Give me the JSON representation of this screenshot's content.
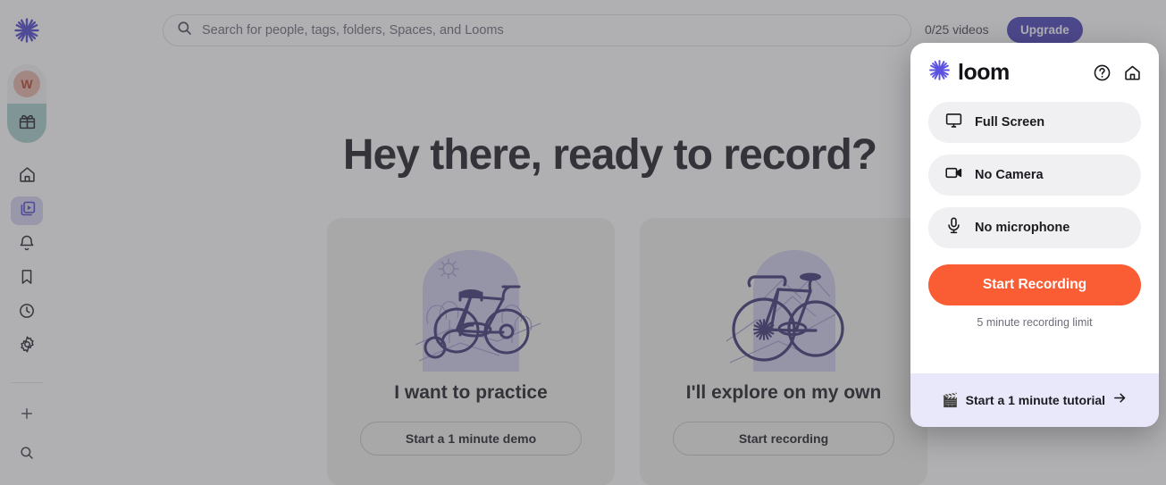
{
  "topbar": {
    "search_placeholder": "Search for people, tags, folders, Spaces, and Looms",
    "search_value": "",
    "search_icon": "search-icon",
    "videos_count": "0/25 videos",
    "upgrade_label": "Upgrade",
    "avatar": "user-avatar"
  },
  "sidebar": {
    "logo": "loom-logo",
    "avatar_initial": "W",
    "avatar_bg": "#e8b5a8",
    "gift_bg": "#a8d0cb",
    "items": [
      {
        "name": "home",
        "icon": "home-icon",
        "active": false
      },
      {
        "name": "library",
        "icon": "library-video-icon",
        "active": true
      },
      {
        "name": "notifications",
        "icon": "bell-icon",
        "active": false
      },
      {
        "name": "bookmarks",
        "icon": "bookmark-icon",
        "active": false
      },
      {
        "name": "history",
        "icon": "clock-icon",
        "active": false
      },
      {
        "name": "settings",
        "icon": "gear-icon",
        "active": false
      }
    ],
    "bottom_items": [
      {
        "name": "new",
        "icon": "plus-icon"
      },
      {
        "name": "search",
        "icon": "search-icon"
      }
    ]
  },
  "main": {
    "headline": "Hey there, ready to record?",
    "cards": [
      {
        "illustration": "bicycle-with-training-wheels-illustration",
        "title": "I want to practice",
        "button": "Start a 1 minute demo"
      },
      {
        "illustration": "road-bicycle-illustration",
        "title": "I'll explore on my own",
        "button": "Start recording"
      }
    ]
  },
  "panel": {
    "brand": "loom",
    "brand_logo": "loom-logo",
    "help_icon": "question-circle-icon",
    "home_icon": "home-icon",
    "options": [
      {
        "icon": "monitor-icon",
        "label": "Full Screen"
      },
      {
        "icon": "video-camera-icon",
        "label": "No Camera"
      },
      {
        "icon": "microphone-icon",
        "label": "No microphone"
      }
    ],
    "record_button": "Start Recording",
    "record_button_color": "#fa5c34",
    "limit_note": "5 minute recording limit",
    "footer": {
      "emoji": "🎬",
      "label": "Start a 1 minute tutorial",
      "arrow_icon": "arrow-right-icon",
      "bg": "#e9e7fa"
    }
  }
}
